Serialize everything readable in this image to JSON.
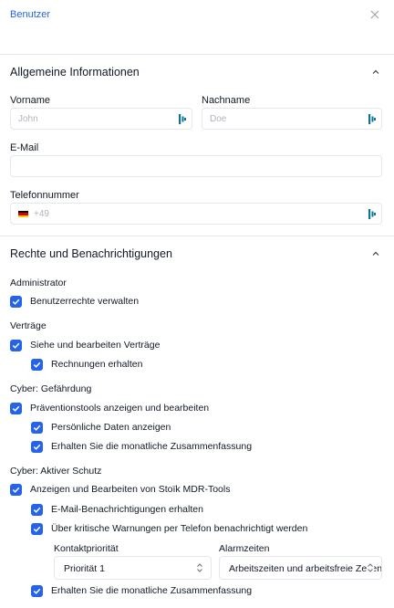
{
  "header": {
    "title": "Benutzer",
    "close_icon": "close-icon"
  },
  "general": {
    "title": "Allgemeine Informationen",
    "first_name": {
      "label": "Vorname",
      "placeholder": "John"
    },
    "last_name": {
      "label": "Nachname",
      "placeholder": "Doe"
    },
    "email": {
      "label": "E-Mail",
      "placeholder": ""
    },
    "phone": {
      "label": "Telefonnummer",
      "placeholder": "+49",
      "flag": "de-flag-icon"
    }
  },
  "rights": {
    "title": "Rechte und Benachrichtigungen",
    "groups": [
      {
        "title": "Administrator",
        "items": [
          {
            "label": "Benutzerrechte verwalten",
            "checked": true,
            "level": 0
          }
        ]
      },
      {
        "title": "Verträge",
        "items": [
          {
            "label": "Siehe und bearbeiten Verträge",
            "checked": true,
            "level": 0
          },
          {
            "label": "Rechnungen erhalten",
            "checked": true,
            "level": 1
          }
        ]
      },
      {
        "title": "Cyber: Gefährdung",
        "items": [
          {
            "label": "Präventionstools anzeigen und bearbeiten",
            "checked": true,
            "level": 0
          },
          {
            "label": "Persönliche Daten anzeigen",
            "checked": true,
            "level": 1
          },
          {
            "label": "Erhalten Sie die monatliche Zusammenfassung",
            "checked": true,
            "level": 1
          }
        ]
      },
      {
        "title": "Cyber: Aktiver Schutz",
        "items": [
          {
            "label": "Anzeigen und Bearbeiten von Stoïk MDR-Tools",
            "checked": true,
            "level": 0
          },
          {
            "label": "E-Mail-Benachrichtigungen erhalten",
            "checked": true,
            "level": 1
          },
          {
            "label": "Über kritische Warnungen per Telefon benachrichtigt werden",
            "checked": true,
            "level": 1
          },
          {
            "label": "Erhalten Sie die monatliche Zusammenfassung",
            "checked": true,
            "level": 1
          }
        ]
      }
    ],
    "contact_priority": {
      "label": "Kontaktpriorität",
      "value": "Priorität 1"
    },
    "alarm_times": {
      "label": "Alarmzeiten",
      "value": "Arbeitszeiten und arbeitsfreie Zeiten"
    }
  },
  "colors": {
    "accent": "#2563eb",
    "border": "#e5e7eb",
    "placeholder": "#b0b5bd",
    "pw_icon": "#0e7490"
  }
}
